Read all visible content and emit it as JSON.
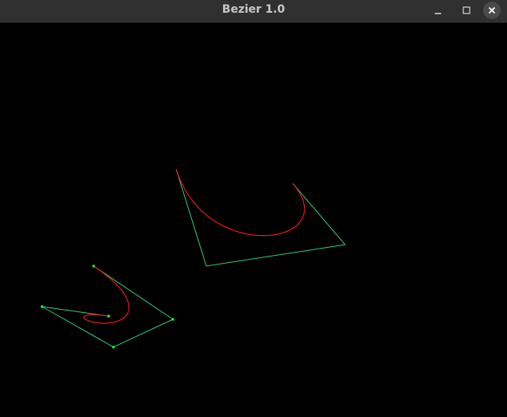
{
  "window": {
    "title": "Bezier 1.0",
    "controls": {
      "minimize_icon": "minimize-icon",
      "maximize_icon": "maximize-icon",
      "close_icon": "close-icon"
    }
  },
  "colors": {
    "background": "#000000",
    "titlebar": "#303030",
    "title_text": "#c8c8c8",
    "control_polygon": "#2ecf7a",
    "control_point": "#33ff33",
    "curve": "#ff1a1a"
  },
  "scene": {
    "curves": [
      {
        "name": "large-curve",
        "control_points": [
          [
            222,
            213
          ],
          [
            260,
            335
          ],
          [
            435,
            308
          ],
          [
            369,
            231
          ]
        ],
        "show_point_markers": false
      },
      {
        "name": "small-curve",
        "control_points": [
          [
            118,
            335
          ],
          [
            218,
            402
          ],
          [
            143,
            437
          ],
          [
            53,
            386
          ],
          [
            137,
            398
          ]
        ],
        "show_point_markers": true
      }
    ]
  }
}
